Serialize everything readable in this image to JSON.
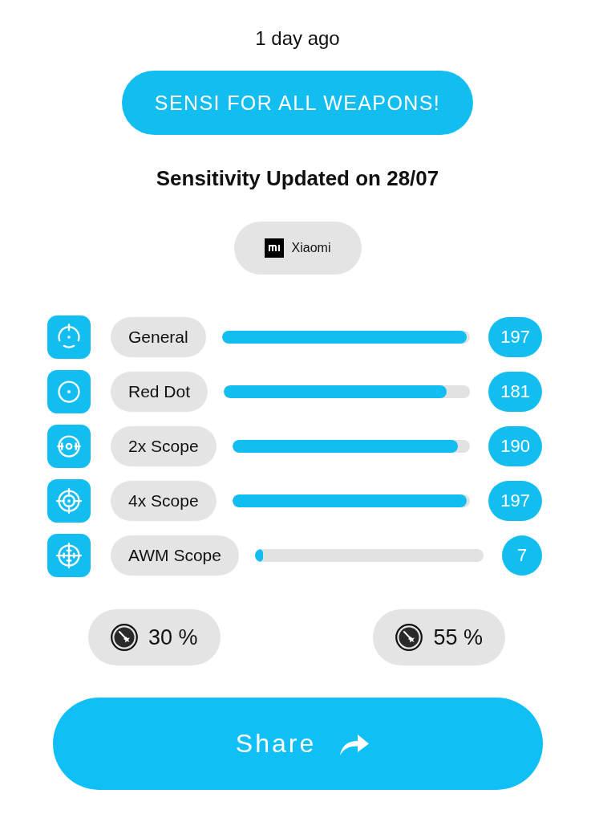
{
  "timestamp": "1 day ago",
  "header_button": {
    "label": "SENSI FOR ALL WEAPONS!"
  },
  "heading": "Sensitivity Updated on 28/07",
  "device_chip": {
    "label": "Xiaomi"
  },
  "settings": [
    {
      "kind": "general",
      "label": "General",
      "level": 0.985,
      "value": "197"
    },
    {
      "kind": "red-dot",
      "label": "Red Dot",
      "level": 0.905,
      "value": "181"
    },
    {
      "kind": "scope-2x",
      "label": "2x Scope",
      "level": 0.95,
      "value": "190"
    },
    {
      "kind": "scope-4x",
      "label": "4x Scope",
      "level": 0.985,
      "value": "197"
    },
    {
      "kind": "scope-awm",
      "label": "AWM Scope",
      "level": 0.035,
      "value": "7"
    }
  ],
  "bottom_stats": [
    {
      "value": "30 %"
    },
    {
      "value": "55 %"
    }
  ],
  "share_button": {
    "label": "Share"
  }
}
